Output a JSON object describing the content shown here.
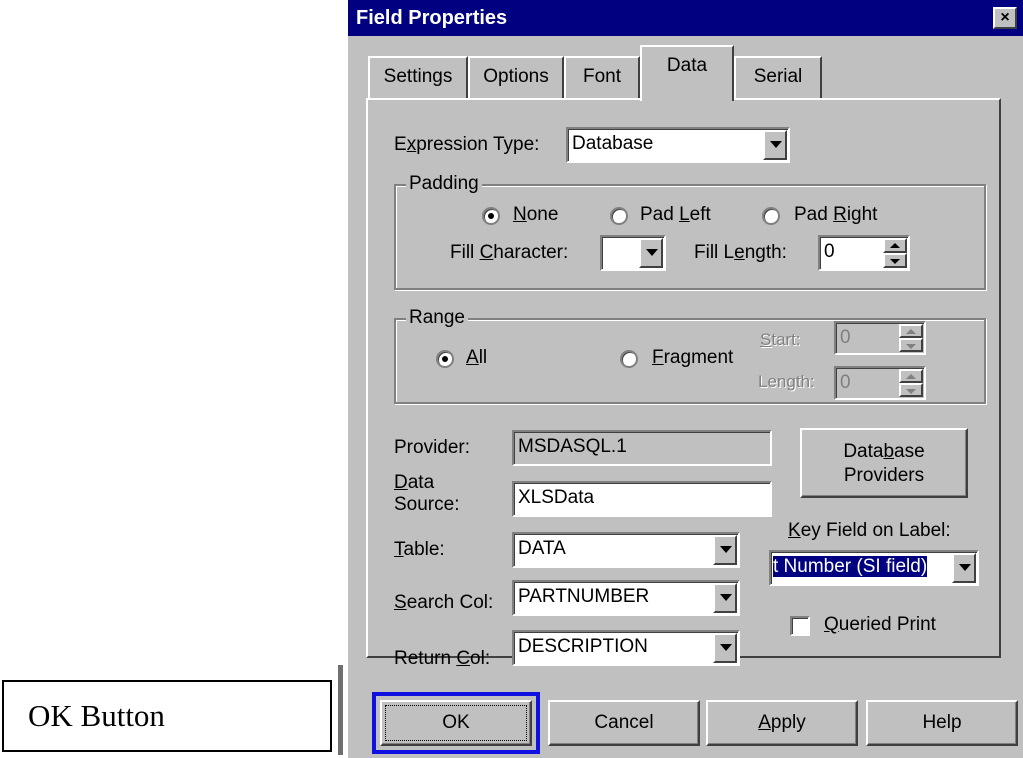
{
  "callout": {
    "label": "OK Button"
  },
  "dialog": {
    "title": "Field Properties",
    "close_glyph": "×",
    "tabs": [
      {
        "label": "Settings"
      },
      {
        "label": "Options"
      },
      {
        "label": "Font"
      },
      {
        "label": "Data",
        "active": true
      },
      {
        "label": "Serial"
      }
    ],
    "expression_type": {
      "label_pre": "E",
      "label_u": "x",
      "label_post": "pression Type:",
      "value": "Database"
    },
    "padding": {
      "legend": "Padding",
      "options": [
        {
          "u": "N",
          "rest": "one",
          "selected": true
        },
        {
          "pre": "Pad ",
          "u": "L",
          "rest": "eft",
          "selected": false
        },
        {
          "pre": "Pad ",
          "u": "R",
          "rest": "ight",
          "selected": false
        }
      ],
      "fill_character": {
        "label_pre": "Fill ",
        "label_u": "C",
        "label_post": "haracter:",
        "value": ""
      },
      "fill_length": {
        "label_pre": "Fill L",
        "label_u": "e",
        "label_post": "ngth:",
        "value": "0"
      }
    },
    "range": {
      "legend": "Range",
      "all": {
        "u": "A",
        "rest": "ll",
        "selected": true
      },
      "fragment": {
        "u": "F",
        "rest": "ragment",
        "selected": false
      },
      "start": {
        "label_u": "S",
        "label_post": "tart:",
        "value": "0"
      },
      "length": {
        "label_pre": "Len",
        "label_u": "g",
        "label_post": "th:",
        "value": "0"
      }
    },
    "provider": {
      "label": "Provider:",
      "value": "MSDASQL.1"
    },
    "data_source": {
      "label_u": "D",
      "label_l1": "ata",
      "label_l2": "Source:",
      "value": "XLSData"
    },
    "table": {
      "label_u": "T",
      "label_post": "able:",
      "value": "DATA"
    },
    "search_col": {
      "label_u": "S",
      "label_post": "earch Col:",
      "value": "PARTNUMBER"
    },
    "return_col": {
      "label_pre": "Return ",
      "label_u": "C",
      "label_post": "ol:",
      "value": "DESCRIPTION"
    },
    "database_providers": {
      "line1_pre": "Data",
      "line1_u": "b",
      "line1_post": "ase",
      "line2": "Providers"
    },
    "key_field": {
      "label_u": "K",
      "label_post": "ey Field on Label:",
      "value": "t Number (SI field)"
    },
    "queried_print": {
      "label_u": "Q",
      "label_post": "ueried Print",
      "checked": false
    },
    "buttons": {
      "ok": "OK",
      "cancel": "Cancel",
      "apply_u": "A",
      "apply_post": "pply",
      "help": "Help"
    },
    "colors": {
      "titlebar": "#000080",
      "face": "#c0c0c0",
      "focus_ring": "#1010e0"
    }
  }
}
